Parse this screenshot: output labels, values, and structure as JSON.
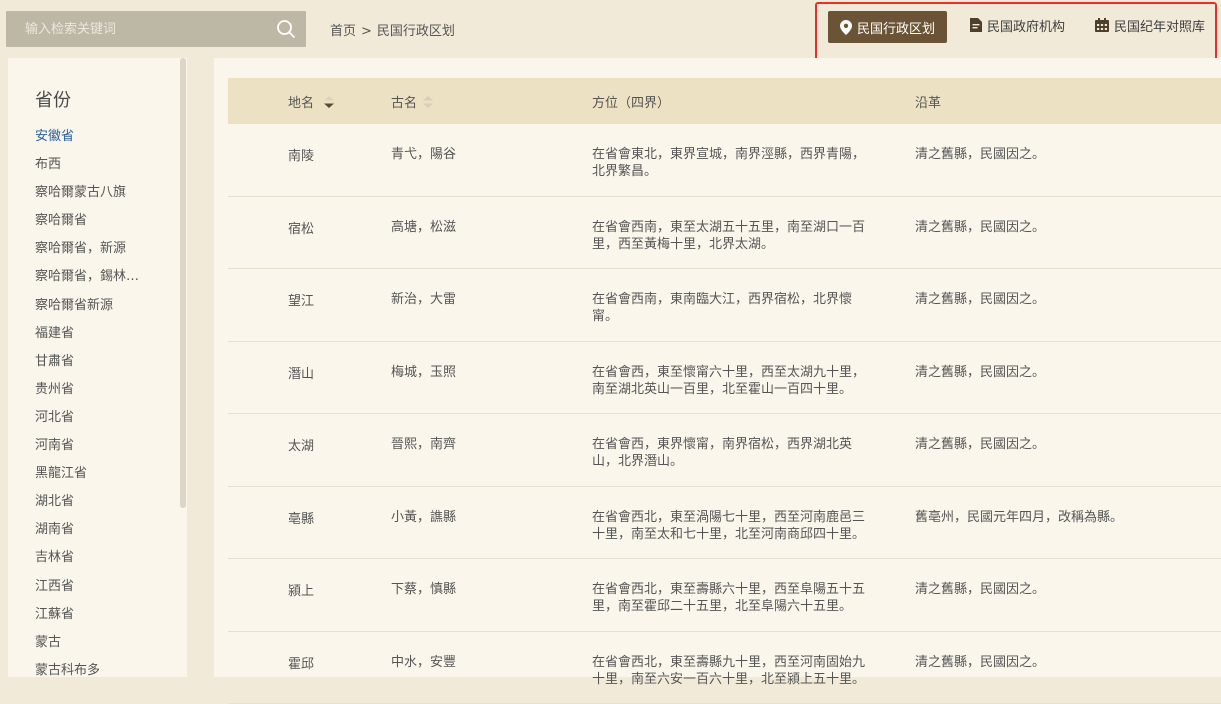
{
  "search": {
    "placeholder": "输入检索关键词"
  },
  "breadcrumb": {
    "home": "首页",
    "separator": ">",
    "current": "民国行政区划"
  },
  "nav": {
    "items": [
      {
        "label": "民国行政区划",
        "icon": "map-pin-icon",
        "active": true
      },
      {
        "label": "民国政府机构",
        "icon": "document-icon",
        "active": false
      },
      {
        "label": "民国纪年对照库",
        "icon": "calendar-icon",
        "active": false
      }
    ]
  },
  "sidebar": {
    "title": "省份",
    "items": [
      "安徽省",
      "布西",
      "察哈爾蒙古八旗",
      "察哈爾省",
      "察哈爾省，新源",
      "察哈爾省，錫林…",
      "察哈爾省新源",
      "福建省",
      "甘肅省",
      "贵州省",
      "河北省",
      "河南省",
      "黑龍江省",
      "湖北省",
      "湖南省",
      "吉林省",
      "江西省",
      "江蘇省",
      "蒙古",
      "蒙古科布多"
    ],
    "selected_index": 0
  },
  "table": {
    "headers": {
      "name": "地名",
      "old_name": "古名",
      "location": "方位（四界）",
      "history": "沿革"
    },
    "rows": [
      {
        "name": "南陵",
        "old_name": "青弋，陽谷",
        "location": "在省會東北，東界宣城，南界涇縣，西界青陽，北界繁昌。",
        "history": "清之舊縣，民國因之。"
      },
      {
        "name": "宿松",
        "old_name": "高塘，松滋",
        "location": "在省會西南，東至太湖五十五里，南至湖口一百里，西至黃梅十里，北界太湖。",
        "history": "清之舊縣，民國因之。"
      },
      {
        "name": "望江",
        "old_name": "新治，大雷",
        "location": "在省會西南，東南臨大江，西界宿松，北界懷甯。",
        "history": "清之舊縣，民國因之。"
      },
      {
        "name": "潛山",
        "old_name": "梅城，玉照",
        "location": "在省會西，東至懷甯六十里，西至太湖九十里，南至湖北英山一百里，北至霍山一百四十里。",
        "history": "清之舊縣，民國因之。"
      },
      {
        "name": "太湖",
        "old_name": "晉熙，南齊",
        "location": "在省會西，東界懷甯，南界宿松，西界湖北英山，北界潛山。",
        "history": "清之舊縣，民國因之。"
      },
      {
        "name": "亳縣",
        "old_name": "小黃，譙縣",
        "location": "在省會西北，東至渦陽七十里，西至河南鹿邑三十里，南至太和七十里，北至河南商邱四十里。",
        "history": "舊亳州，民國元年四月，改稱為縣。"
      },
      {
        "name": "潁上",
        "old_name": "下蔡，慎縣",
        "location": "在省會西北，東至壽縣六十里，西至阜陽五十五里，南至霍邱二十五里，北至阜陽六十五里。",
        "history": "清之舊縣，民國因之。"
      },
      {
        "name": "霍邱",
        "old_name": "中水，安豐",
        "location": "在省會西北，東至壽縣九十里，西至河南固始九十里，南至六安一百六十里，北至潁上五十里。",
        "history": "清之舊縣，民國因之。"
      }
    ]
  },
  "colors": {
    "active_nav": "#6b5436",
    "highlight_border": "#e8302a",
    "header_bg": "#ede1c3",
    "selected_link": "#2b5e9a"
  }
}
